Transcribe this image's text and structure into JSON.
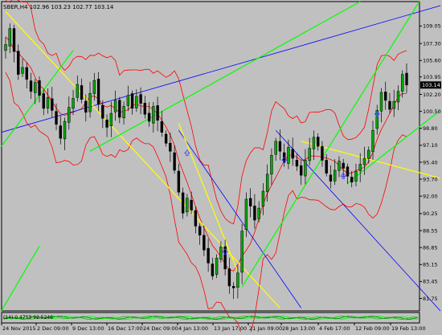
{
  "header": {
    "title": "SBER,H4  102.96 103.23 102.77 103.14"
  },
  "indicator": {
    "label": "(14) 0.4753 92.5246",
    "colors": {
      "line1": "#00ff00",
      "line2": "#008000",
      "line3": "#00c800"
    }
  },
  "colors": {
    "background": "#c0c0c0",
    "frame": "#000000",
    "candle_up": "#00aa00",
    "candle_down": "#000000",
    "bollinger": "#ff0000",
    "fan_blue": "#0000ff",
    "trend_yellow": "#ffff00",
    "trend_green": "#00ff00",
    "current_price_bg": "#000000",
    "current_price_fg": "#ffffff",
    "arrow": "#4040ff"
  },
  "chart_data": {
    "type": "candlestick",
    "symbol": "SBER",
    "timeframe": "H4",
    "ohlc_header": {
      "open": 102.96,
      "high": 103.23,
      "low": 102.77,
      "close": 103.14
    },
    "current_price": 103.14,
    "ylim": [
      80.5,
      111.5
    ],
    "y_ticks": [
      109.05,
      107.3,
      105.6,
      103.95,
      102.2,
      100.5,
      98.8,
      97.1,
      95.4,
      93.7,
      92.0,
      90.25,
      88.55,
      86.85,
      85.15,
      83.45,
      81.75
    ],
    "x_ticks": [
      "24 Nov 2015",
      "2 Dec 09:00",
      "9 Dec 13:00",
      "16 Dec 17:00",
      "24 Dec 09:00",
      "4 Jan 13:00",
      "13 Jan 17:00",
      "21 Jan 09:00",
      "28 Jan 13:00",
      "4 Feb 17:00",
      "12 Feb 09:00",
      "19 Feb 13:00"
    ],
    "close_path": [
      107.2,
      108.8,
      106.5,
      104.2,
      104.9,
      103.7,
      102.5,
      103.4,
      102.1,
      100.8,
      101.9,
      100.6,
      99.2,
      97.8,
      99.5,
      100.9,
      101.8,
      103.2,
      101.7,
      100.4,
      102.3,
      103.6,
      101.2,
      99.8,
      98.9,
      100.3,
      101.6,
      99.9,
      101.0,
      102.1,
      100.8,
      102.0,
      101.3,
      100.2,
      99.5,
      101.0,
      99.6,
      98.4,
      97.3,
      96.5,
      94.6,
      92.4,
      90.3,
      91.8,
      90.6,
      89.0,
      88.1,
      86.6,
      85.3,
      84.0,
      85.8,
      86.9,
      84.7,
      83.0,
      82.8,
      84.3,
      88.5,
      91.7,
      91.0,
      89.6,
      90.8,
      92.5,
      94.2,
      96.1,
      97.5,
      96.5,
      95.4,
      96.9,
      95.8,
      95.0,
      94.1,
      95.6,
      96.8,
      97.9,
      97.0,
      95.6,
      94.3,
      93.5,
      94.6,
      95.5,
      94.8,
      94.0,
      93.4,
      94.5,
      95.2,
      95.8,
      96.6,
      98.6,
      100.6,
      102.4,
      101.6,
      100.7,
      101.5,
      102.5,
      104.2,
      103.14
    ]
  }
}
